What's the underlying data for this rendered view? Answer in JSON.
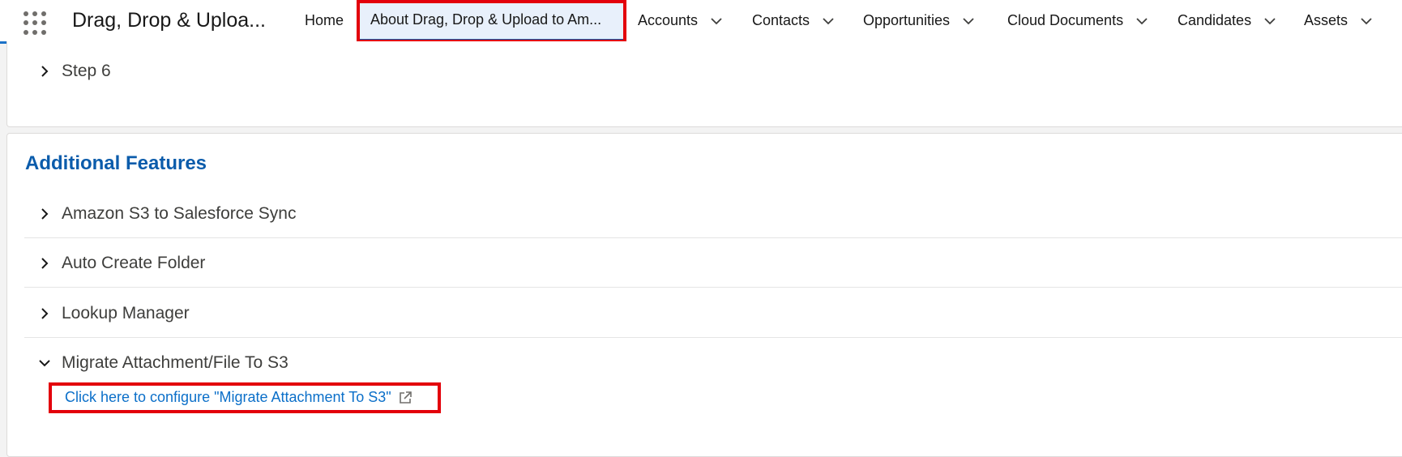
{
  "app": {
    "name": "Drag, Drop & Uploa..."
  },
  "nav": {
    "items": [
      {
        "label": "Home",
        "has_menu": false,
        "active": false
      },
      {
        "label": "About Drag, Drop & Upload to Am...",
        "has_menu": false,
        "active": true
      },
      {
        "label": "Accounts",
        "has_menu": true,
        "active": false
      },
      {
        "label": "Contacts",
        "has_menu": true,
        "active": false
      },
      {
        "label": "Opportunities",
        "has_menu": true,
        "active": false
      },
      {
        "label": "Cloud Documents",
        "has_menu": true,
        "active": false
      },
      {
        "label": "Candidates",
        "has_menu": true,
        "active": false
      },
      {
        "label": "Assets",
        "has_menu": true,
        "active": false
      }
    ]
  },
  "steps": {
    "step6_label": "Step 6"
  },
  "additional_features": {
    "title": "Additional Features",
    "items": [
      {
        "label": "Amazon S3 to Salesforce Sync",
        "expanded": false
      },
      {
        "label": "Auto Create Folder",
        "expanded": false
      },
      {
        "label": "Lookup Manager",
        "expanded": false
      },
      {
        "label": "Migrate Attachment/File To S3",
        "expanded": true
      }
    ],
    "migrate_link": "Click here to configure \"Migrate Attachment To S3\""
  },
  "icons": {
    "app_launcher": "waffle-icon",
    "dropdown": "chevron-down-icon",
    "collapsed": "chevron-right-icon",
    "expanded": "chevron-down-icon",
    "external_link": "external-link-icon"
  },
  "colors": {
    "nav_underline": "#1b72c8",
    "active_tab_bg": "#e8f0fb",
    "section_title": "#0b5cab",
    "link": "#0b6fc9",
    "highlight": "#e3000b"
  }
}
